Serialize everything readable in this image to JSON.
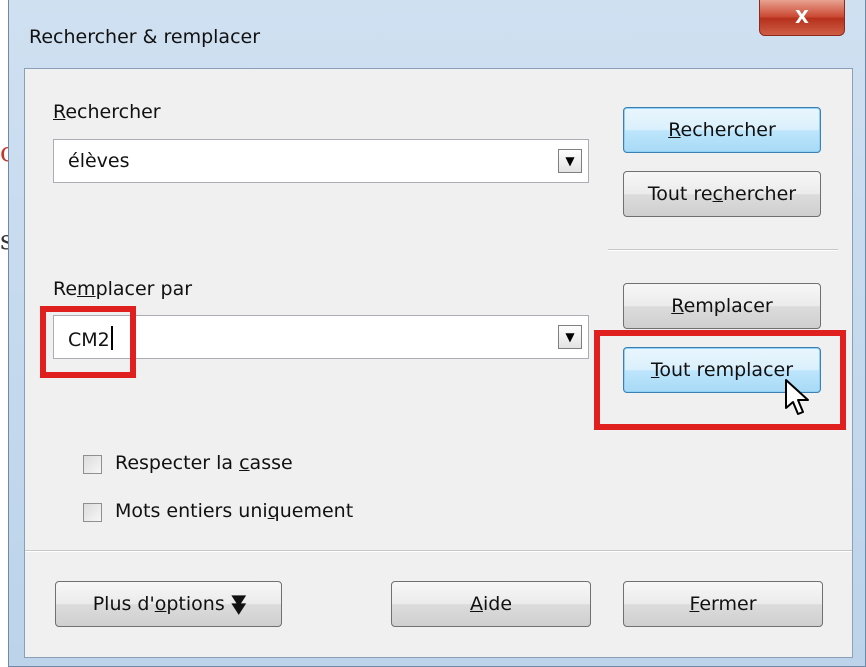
{
  "window": {
    "title": "Rechercher & remplacer",
    "close_label": "X"
  },
  "search": {
    "label": "Rechercher",
    "label_access_key": "R",
    "label_rest": "echercher",
    "value": "élèves"
  },
  "replace": {
    "label_pre": "Re",
    "label_key": "m",
    "label_rest": "placer par",
    "value": "CM2"
  },
  "buttons": {
    "find_key": "R",
    "find_rest": "echercher",
    "find_all_pre": "Tout re",
    "find_all_key": "c",
    "find_all_rest": "hercher",
    "replace_key": "R",
    "replace_rest": "emplacer",
    "replace_all_key": "T",
    "replace_all_rest": "out remplacer",
    "more_options_pre": "Plus d'",
    "more_options_key": "o",
    "more_options_rest": "ptions",
    "more_options_icon": "double-chevron-down-icon",
    "help_key": "A",
    "help_rest": "ide",
    "close_key": "F",
    "close_rest": "ermer"
  },
  "options": {
    "match_case_pre": "Respecter la ",
    "match_case_key": "c",
    "match_case_rest": "asse",
    "match_case_checked": false,
    "whole_words_pre": "Mots entiers uni",
    "whole_words_key": "q",
    "whole_words_rest": "uement",
    "whole_words_checked": false
  },
  "background": {
    "glyph_1": "c",
    "glyph_2": "s"
  },
  "colors": {
    "highlight": "#e0201f",
    "focus_button": "#bee6fd",
    "close_button": "#c9452f"
  }
}
